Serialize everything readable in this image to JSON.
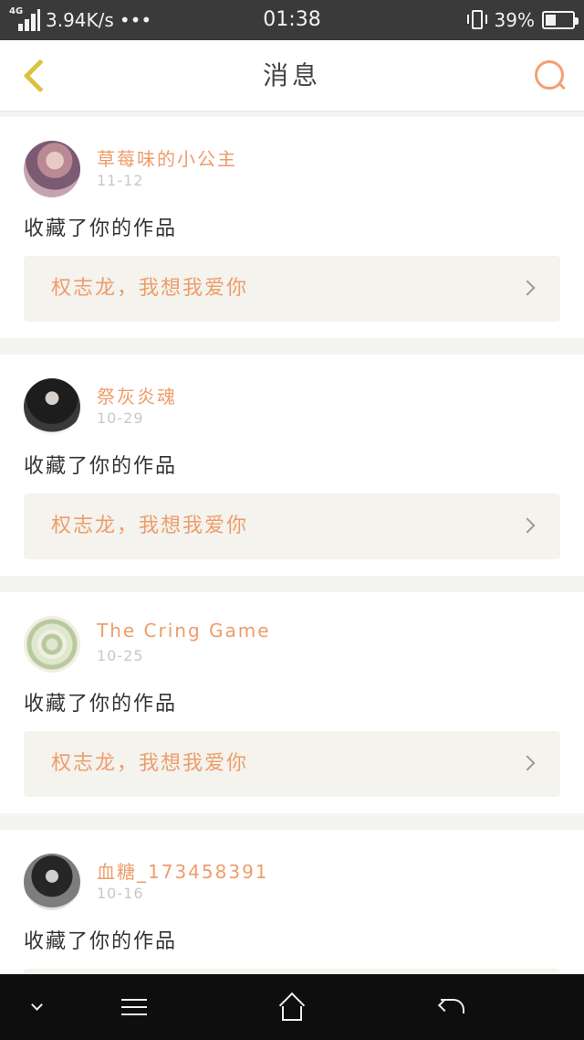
{
  "status_bar": {
    "network": "4G",
    "speed": "3.94K/s",
    "more": "•••",
    "time": "01:38",
    "battery": "39%",
    "battery_level": 0.39
  },
  "header": {
    "title": "消息",
    "back_icon": "chevron-left-icon",
    "search_icon": "search-icon"
  },
  "colors": {
    "accent": "#ee9d6a",
    "back": "#ddc13a",
    "search": "#f2a071",
    "card_box": "#f4f3ee"
  },
  "messages": [
    {
      "username": "草莓味的小公主",
      "date": "11-12",
      "action": "收藏了你的作品",
      "work_title": "权志龙，我想我爱你"
    },
    {
      "username": "祭灰炎魂",
      "date": "10-29",
      "action": "收藏了你的作品",
      "work_title": "权志龙，我想我爱你"
    },
    {
      "username": "The Cring Game",
      "date": "10-25",
      "action": "收藏了你的作品",
      "work_title": "权志龙，我想我爱你"
    },
    {
      "username": "血糖_173458391",
      "date": "10-16",
      "action": "收藏了你的作品",
      "work_title": ""
    }
  ],
  "nav": {
    "icons": [
      "chevron-down-icon",
      "menu-icon",
      "home-icon",
      "back-icon"
    ]
  }
}
